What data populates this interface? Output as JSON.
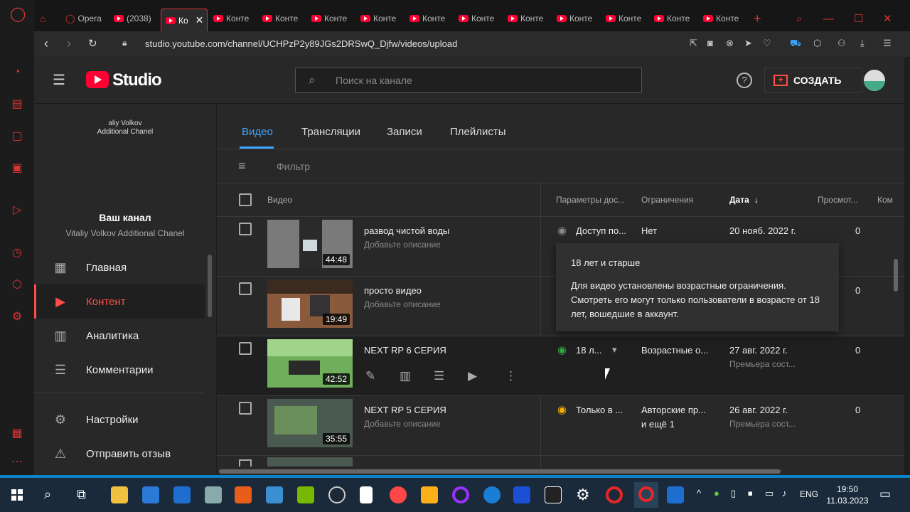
{
  "tabs": [
    "Opera",
    "(2038)",
    "Ко",
    "Конте",
    "Конте",
    "Конте",
    "Конте",
    "Конте",
    "Конте",
    "Конте",
    "Конте",
    "Конте"
  ],
  "address": {
    "url": "studio.youtube.com/channel/UCHPzP2y89JGs2DRSwQ_Djfw/videos/upload"
  },
  "header": {
    "logo_text": "Studio",
    "search_placeholder": "Поиск на канале",
    "create_label": "СОЗДАТЬ"
  },
  "sidebar": {
    "channel_logo_line1": "aliy Volkov",
    "channel_logo_line2": "Additional Chanel",
    "your_channel": "Ваш канал",
    "channel_name": "Vitaliy Volkov Additional Chanel",
    "items": [
      {
        "label": "Главная",
        "icon": "dashboard-icon"
      },
      {
        "label": "Контент",
        "icon": "content-icon"
      },
      {
        "label": "Аналитика",
        "icon": "analytics-icon"
      },
      {
        "label": "Комментарии",
        "icon": "comments-icon"
      },
      {
        "label": "Настройки",
        "icon": "settings-icon"
      },
      {
        "label": "Отправить отзыв",
        "icon": "feedback-icon"
      }
    ]
  },
  "content_tabs": [
    "Видео",
    "Трансляции",
    "Записи",
    "Плейлисты"
  ],
  "filter_label": "Фильтр",
  "table_headers": {
    "video": "Видео",
    "visibility": "Параметры дос...",
    "restrictions": "Ограничения",
    "date": "Дата",
    "views": "Просмот...",
    "comments": "Ком"
  },
  "rows": [
    {
      "title": "развод чистой воды",
      "desc": "Добавьте описание",
      "duration": "44:48",
      "visibility": "Доступ по...",
      "restriction": "Нет",
      "date": "20 нояб. 2022 г.",
      "date_sub": "",
      "views": "0"
    },
    {
      "title": "просто видео",
      "desc": "Добавьте описание",
      "duration": "19:49",
      "visibility": "",
      "restriction": "",
      "date": "",
      "date_sub": "",
      "views": "0"
    },
    {
      "title": "NEXT RP 6 СЕРИЯ",
      "desc": "",
      "duration": "42:52",
      "visibility": "18 л...",
      "restriction": "Возрастные о...",
      "date": "27 авг. 2022 г.",
      "date_sub": "Премьера сост...",
      "views": "0"
    },
    {
      "title": "NEXT RP 5 СЕРИЯ",
      "desc": "Добавьте описание",
      "duration": "35:55",
      "visibility": "Только в ...",
      "restriction": "Авторские пр...",
      "restriction2": "и ещё 1",
      "date": "26 авг. 2022 г.",
      "date_sub": "Премьера сост...",
      "views": "0"
    }
  ],
  "tooltip": {
    "title": "18 лет и старше",
    "body": "Для видео установлены возрастные ограничения. Смотреть его могут только пользователи в возрасте от 18 лет, вошедшие в аккаунт."
  },
  "taskbar": {
    "lang": "ENG",
    "time": "19:50",
    "date": "11.03.2023"
  },
  "colors": {
    "accent": "#3ea6ff",
    "red": "#ff0033",
    "visibility_green": "#2ba640",
    "visibility_yellow": "#f9ab00"
  }
}
